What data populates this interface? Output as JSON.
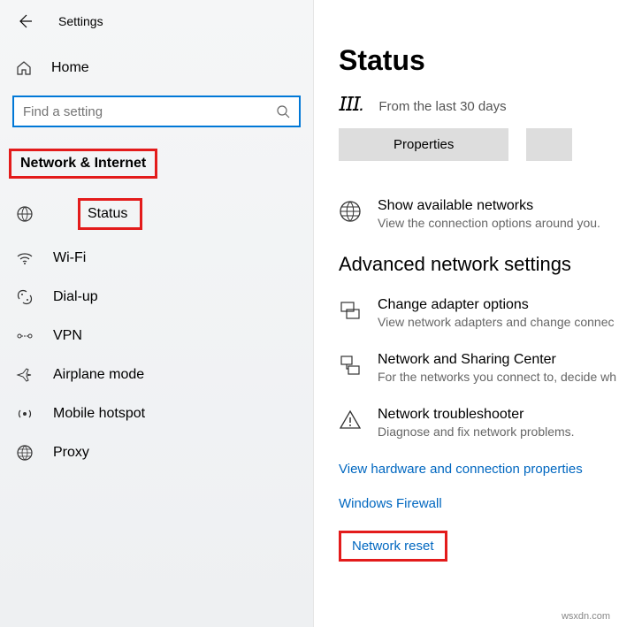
{
  "header": {
    "back": "←",
    "title": "Settings"
  },
  "sidebar": {
    "home": "Home",
    "search_placeholder": "Find a setting",
    "section": "Network & Internet",
    "items": [
      {
        "label": "Status"
      },
      {
        "label": "Wi-Fi"
      },
      {
        "label": "Dial-up"
      },
      {
        "label": "VPN"
      },
      {
        "label": "Airplane mode"
      },
      {
        "label": "Mobile hotspot"
      },
      {
        "label": "Proxy"
      }
    ]
  },
  "main": {
    "title": "Status",
    "subtitle": "From the last 30 days",
    "properties_btn": "Properties",
    "available": {
      "title": "Show available networks",
      "desc": "View the connection options around you."
    },
    "adv_title": "Advanced network settings",
    "adapter": {
      "title": "Change adapter options",
      "desc": "View network adapters and change connec"
    },
    "sharing": {
      "title": "Network and Sharing Center",
      "desc": "For the networks you connect to, decide wh"
    },
    "trouble": {
      "title": "Network troubleshooter",
      "desc": "Diagnose and fix network problems."
    },
    "links": {
      "hw": "View hardware and connection properties",
      "fw": "Windows Firewall",
      "reset": "Network reset"
    }
  },
  "watermark": "wsxdn.com"
}
